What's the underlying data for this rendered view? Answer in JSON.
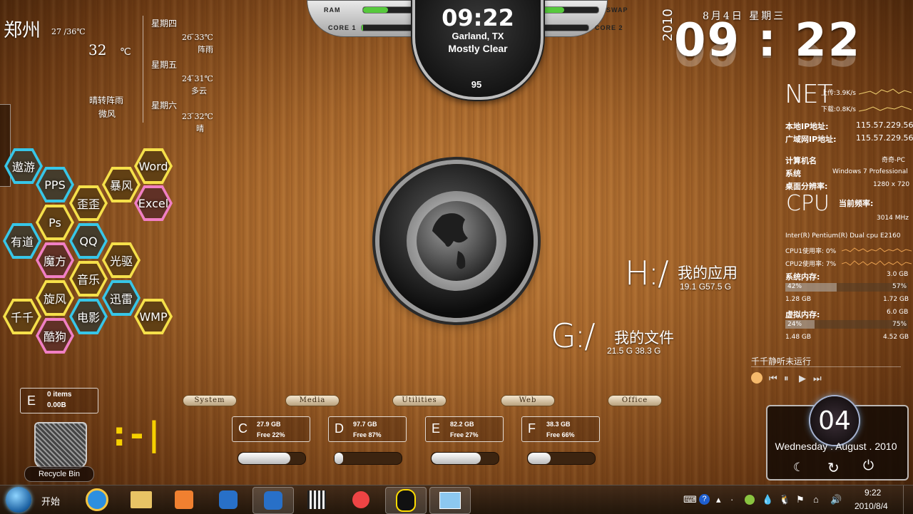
{
  "weather_left": {
    "city": "郑州",
    "range": "27 /36℃",
    "temp": "32",
    "unit": "℃",
    "desc1": "晴转阵雨",
    "desc2": "微风",
    "forecast": [
      {
        "day": "星期四",
        "range": "26 ̄33℃",
        "desc": "阵雨"
      },
      {
        "day": "星期五",
        "range": "24 ̄31℃",
        "desc": "多云"
      },
      {
        "day": "星期六",
        "range": "23 ̄32℃",
        "desc": "晴"
      }
    ]
  },
  "hex_apps": [
    "遨游",
    "PPS",
    "歪歪",
    "暴风",
    "Word",
    "Excel",
    "Ps",
    "有道",
    "QQ",
    "魔方",
    "光驱",
    "音乐",
    "旋风",
    "迅雷",
    "千千",
    "电影",
    "WMP",
    "酷狗"
  ],
  "top_gauge": {
    "ram_label": "RAM",
    "swap_label": "SWAP",
    "core1_label": "CORE 1",
    "core2_label": "CORE 2",
    "time": "09:22",
    "location": "Garland, TX",
    "condition": "Mostly Clear",
    "temp": "95",
    "ram": 0.45,
    "swap": 0.5,
    "core1": 0.02,
    "core2": 0.05
  },
  "clock_right": {
    "date": "8月4日 星期三",
    "year": "2010",
    "time": "09 : 22"
  },
  "sysinfo": {
    "net_label": "NET",
    "upload": "上传:3.9K/s",
    "download": "下载:0.8K/s",
    "local_ip_label": "本地IP地址:",
    "local_ip": "115.57.229.56",
    "wan_ip_label": "广域网IP地址:",
    "wan_ip": "115.57.229.56",
    "computer_label": "计算机名",
    "computer": "奇奇-PC",
    "os_label": "系统",
    "os": "Windows 7 Professional",
    "res_label": "桌面分辨率:",
    "res": "1280 x 720",
    "cpu_label": "CPU",
    "freq_label": "当前频率:",
    "freq": "3014 MHz",
    "cpu_name": "Inter(R) Pentium(R) Dual cpu E2160",
    "cpu1": "CPU1使用率: 0%",
    "cpu2": "CPU2使用率: 7%",
    "mem_label": "系统内存:",
    "mem_total": "3.0 GB",
    "mem_pct_left": "42%",
    "mem_pct_right": "57%",
    "mem_used": "1.28 GB",
    "mem_free": "1.72 GB",
    "vmem_label": "虚拟内存:",
    "vmem_total": "6.0 GB",
    "vmem_pct_left": "24%",
    "vmem_pct_right": "75%",
    "vmem_used": "1.48 GB",
    "vmem_free": "4.52 GB",
    "mem_fill": 0.42,
    "vmem_fill": 0.24
  },
  "music": {
    "status": "千千静听未运行"
  },
  "date_widget": {
    "day": "04",
    "date": "Wednesday . August . 2010"
  },
  "drives_big": [
    {
      "letter": "H:/",
      "name": "我的应用",
      "size": "19.1 G57.5 G"
    },
    {
      "letter": "G:/",
      "name": "我的文件",
      "size": "21.5 G 38.3 G"
    }
  ],
  "recycle": {
    "letter": "E",
    "items": "0 items",
    "size": "0.00B",
    "label": "Recycle Bin"
  },
  "tabs": [
    "System",
    "Media",
    "Utilities",
    "Web",
    "Office"
  ],
  "drives": [
    {
      "letter": "C",
      "size": "27.9 GB",
      "free": "Free 22%",
      "fill": 0.78
    },
    {
      "letter": "D",
      "size": "97.7 GB",
      "free": "Free 87%",
      "fill": 0.13
    },
    {
      "letter": "E",
      "size": "82.2 GB",
      "free": "Free 27%",
      "fill": 0.73
    },
    {
      "letter": "F",
      "size": "38.3 GB",
      "free": "Free 66%",
      "fill": 0.34
    }
  ],
  "smile": ":-|",
  "taskbar": {
    "start": "开始",
    "time": "9:22",
    "date": "2010/8/4"
  }
}
